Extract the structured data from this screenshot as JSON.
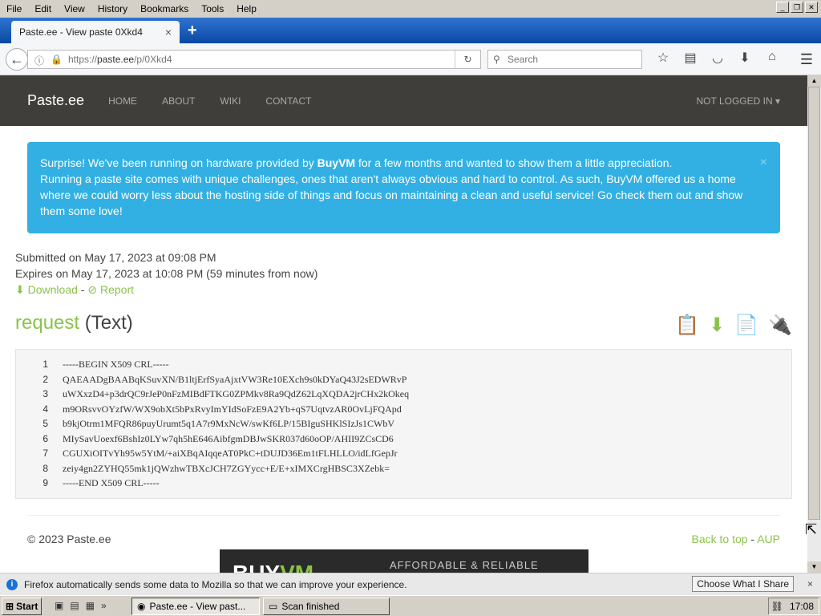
{
  "menu": [
    "File",
    "Edit",
    "View",
    "History",
    "Bookmarks",
    "Tools",
    "Help"
  ],
  "tab": {
    "title": "Paste.ee - View paste 0Xkd4",
    "close": "×",
    "new": "+"
  },
  "nav": {
    "url_prefix": "https://",
    "url_host": "paste.ee",
    "url_path": "/p/0Xkd4",
    "search_placeholder": "Search"
  },
  "site": {
    "brand": "Paste.ee",
    "links": [
      "HOME",
      "ABOUT",
      "WIKI",
      "CONTACT"
    ],
    "account": "NOT LOGGED IN ▾"
  },
  "alert": {
    "line1_pre": "Surprise! We've been running on hardware provided by ",
    "line1_brand": "BuyVM",
    "line1_post": " for a few months and wanted to show them a little appreciation.",
    "line2": "Running a paste site comes with unique challenges, ones that aren't always obvious and hard to control. As such, BuyVM offered us a home where we could worry less about the hosting side of things and focus on maintaining a clean and useful service! Go check them out and show them some love!",
    "close": "×"
  },
  "meta": {
    "submitted": "Submitted on May 17, 2023 at 09:08 PM",
    "expires": "Expires on May 17, 2023 at 10:08 PM (59 minutes from now)",
    "download": "Download",
    "sep": " - ",
    "report": "Report"
  },
  "paste": {
    "name": "request",
    "type": "(Text)",
    "lines": [
      "-----BEGIN X509 CRL-----",
      "QAEAADgBAABqKSuvXN/B1ltjErfSyaAjxtVW3Re10EXch9s0kDYaQ43J2sEDWRvP",
      "uWXxzD4+p3drQC9rJeP0nFzMIBdFTKG0ZPMkv8Ra9QdZ62LqXQDA2jrCHx2kOkeq",
      "m9ORsvvOYzfW/WX9obXt5bPxRvyImYIdSoFzE9A2Yb+qS7UqtvzAR0OvLjFQApd",
      "b9kjOtrm1MFQR86puyUrumt5q1A7r9MxNcW/swKf6LP/15BIguSHKlSIzJs1CWbV",
      "MIySavUoexf6BshIz0LYw7qh5hE646AibfgmDBJwSKR037d60oOP/AHII9ZCsCD6",
      "CGUXiOITvYh95w5YtM/+aiXBqAIqqeAT0PkC+tDUJD36Em1tFLHLLO/idLfGepJr",
      "zeiy4gn2ZYHQ55mk1jQWzhwTBXcJCH7ZGYycc+E/E+xIMXCrgHBSC3XZebk=",
      "-----END X509 CRL-----"
    ]
  },
  "footer": {
    "copyright": "© 2023 Paste.ee",
    "back": "Back to top",
    "sep": " - ",
    "aup": "AUP"
  },
  "ad": {
    "logo_a": "BUY",
    "logo_b": "VM",
    "tagline": "AFFORDABLE & RELIABLE"
  },
  "notification": {
    "text": "Firefox automatically sends some data to Mozilla so that we can improve your experience.",
    "button": "Choose What I Share",
    "close": "×"
  },
  "taskbar": {
    "start": "Start",
    "task1": "Paste.ee - View past...",
    "task2": "Scan finished",
    "clock": "17:08"
  }
}
